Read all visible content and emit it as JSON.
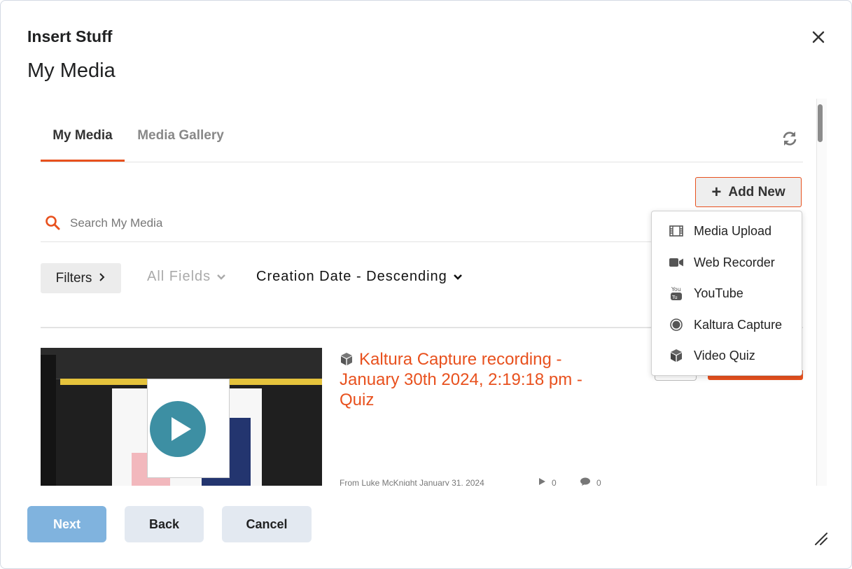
{
  "dialog": {
    "title": "Insert Stuff",
    "close_icon": "close-icon"
  },
  "page": {
    "title": "My Media"
  },
  "tabs": [
    {
      "label": "My Media",
      "active": true
    },
    {
      "label": "Media Gallery",
      "active": false
    }
  ],
  "toolbar": {
    "refresh_icon": "refresh-icon",
    "add_new_label": "Add New"
  },
  "search": {
    "placeholder": "Search My Media",
    "value": ""
  },
  "filters": {
    "filters_label": "Filters",
    "fields_label": "All Fields",
    "sort_label": "Creation Date - Descending"
  },
  "media": [
    {
      "title": "Kaltura Capture recording - January 30th 2024, 2:19:18 pm - Quiz",
      "type_icon": "cube-icon",
      "meta": "From Luke McKnight January 31, 2024",
      "plays": "0",
      "comments": "0"
    }
  ],
  "add_new_menu": [
    {
      "label": "Media Upload",
      "icon": "film-icon"
    },
    {
      "label": "Web Recorder",
      "icon": "video-camera-icon"
    },
    {
      "label": "YouTube",
      "icon": "youtube-icon"
    },
    {
      "label": "Kaltura Capture",
      "icon": "record-icon"
    },
    {
      "label": "Video Quiz",
      "icon": "cube-icon"
    }
  ],
  "footer": {
    "next_label": "Next",
    "back_label": "Back",
    "cancel_label": "Cancel"
  },
  "colors": {
    "accent": "#e8511e",
    "primary_button": "#80b3de",
    "secondary_button": "#e3e9f1"
  }
}
